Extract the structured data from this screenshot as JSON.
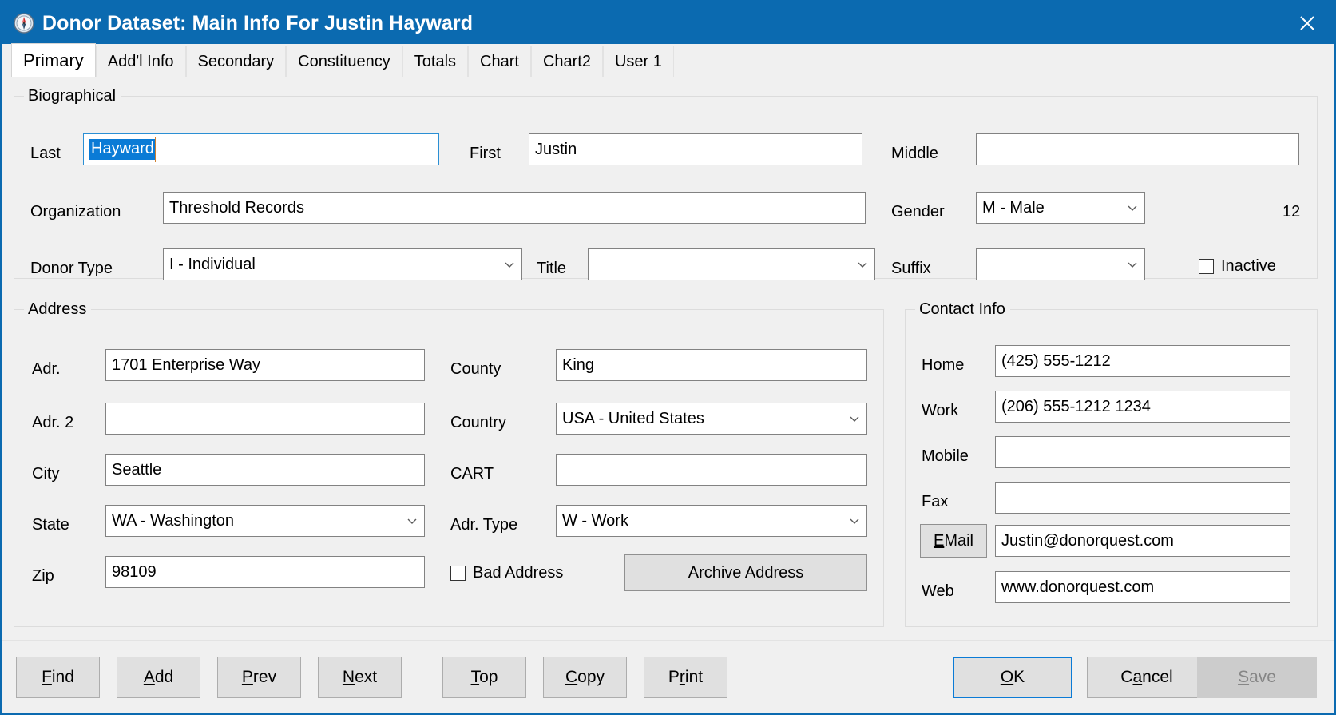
{
  "window": {
    "title": "Donor Dataset: Main Info For Justin Hayward",
    "icon": "compass-icon",
    "close_label": "✕",
    "accent_color": "#0b6ab0",
    "background_color": "#f0f0f0"
  },
  "tabs": [
    {
      "label": "Primary",
      "active": true
    },
    {
      "label": "Add'l Info",
      "active": false
    },
    {
      "label": "Secondary",
      "active": false
    },
    {
      "label": "Constituency",
      "active": false
    },
    {
      "label": "Totals",
      "active": false
    },
    {
      "label": "Chart",
      "active": false
    },
    {
      "label": "Chart2",
      "active": false
    },
    {
      "label": "User 1",
      "active": false
    }
  ],
  "biographical": {
    "legend": "Biographical",
    "last_label": "Last",
    "last_value": "Hayward",
    "last_selected": true,
    "first_label": "First",
    "first_value": "Justin",
    "middle_label": "Middle",
    "middle_value": "",
    "organization_label": "Organization",
    "organization_value": "Threshold Records",
    "gender_label": "Gender",
    "gender_value": "M - Male",
    "record_number": "12",
    "donor_type_label": "Donor Type",
    "donor_type_value": "I - Individual",
    "title_label": "Title",
    "title_value": "",
    "suffix_label": "Suffix",
    "suffix_value": "",
    "inactive_label": "Inactive",
    "inactive_checked": false
  },
  "address": {
    "legend": "Address",
    "adr_label": "Adr.",
    "adr_value": "1701 Enterprise Way",
    "adr2_label": "Adr. 2",
    "adr2_value": "",
    "city_label": "City",
    "city_value": "Seattle",
    "state_label": "State",
    "state_value": "WA - Washington",
    "zip_label": "Zip",
    "zip_value": "98109",
    "county_label": "County",
    "county_value": "King",
    "country_label": "Country",
    "country_value": "USA - United States",
    "cart_label": "CART",
    "cart_value": "",
    "adr_type_label": "Adr. Type",
    "adr_type_value": "W - Work",
    "bad_address_label": "Bad Address",
    "bad_address_checked": false,
    "archive_button_label": "Archive Address"
  },
  "contact": {
    "legend": "Contact Info",
    "home_label": "Home",
    "home_value": "(425) 555-1212",
    "work_label": "Work",
    "work_value": "(206) 555-1212 1234",
    "mobile_label": "Mobile",
    "mobile_value": "",
    "fax_label": "Fax",
    "fax_value": "",
    "email_label": "EMail",
    "email_accel": "E",
    "email_rest": "Mail",
    "email_value": "Justin@donorquest.com",
    "web_label": "Web",
    "web_value": "www.donorquest.com"
  },
  "footer": {
    "buttons": [
      {
        "name": "find",
        "accel": "F",
        "rest": "ind",
        "state": "normal"
      },
      {
        "name": "add",
        "accel": "A",
        "rest": "dd",
        "state": "normal"
      },
      {
        "name": "prev",
        "accel": "P",
        "rest": "rev",
        "state": "normal"
      },
      {
        "name": "next",
        "accel": "N",
        "rest": "ext",
        "state": "normal"
      },
      {
        "name": "top",
        "accel": "T",
        "rest": "op",
        "state": "normal"
      },
      {
        "name": "copy",
        "accel": "C",
        "rest": "opy",
        "state": "normal"
      },
      {
        "name": "print",
        "pre": "P",
        "accel": "r",
        "rest": "int",
        "state": "normal"
      }
    ],
    "ok_accel": "O",
    "ok_rest": "K",
    "ok_label": "OK",
    "cancel_pre": "C",
    "cancel_accel": "a",
    "cancel_rest": "ncel",
    "cancel_label": "Cancel",
    "save_accel": "S",
    "save_rest": "ave",
    "save_label": "Save",
    "save_disabled": true
  }
}
